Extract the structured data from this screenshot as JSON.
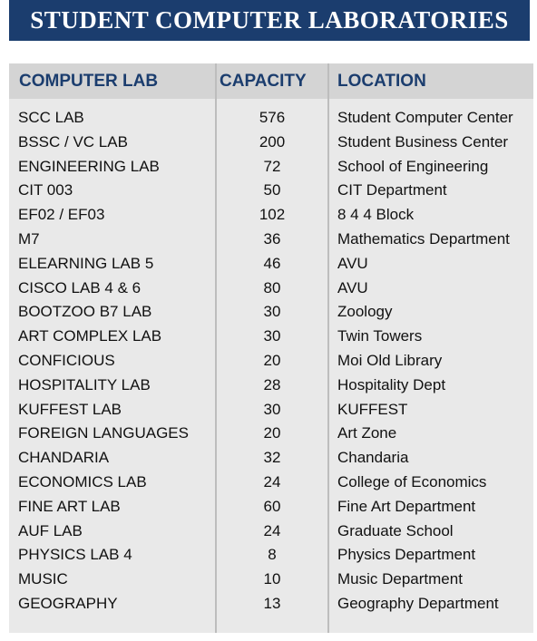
{
  "title": "STUDENT COMPUTER LABORATORIES",
  "colors": {
    "title_background": "#1b3d6e",
    "header_text": "#1b3d6e",
    "header_background": "#d4d4d4",
    "panel_background": "#e9e9e9"
  },
  "table": {
    "headers": [
      "COMPUTER LAB",
      "CAPACITY",
      "LOCATION"
    ],
    "rows": [
      {
        "lab": "SCC LAB",
        "capacity": "576",
        "location": "Student Computer Center"
      },
      {
        "lab": "BSSC / VC LAB",
        "capacity": "200",
        "location": "Student Business Center"
      },
      {
        "lab": "ENGINEERING LAB",
        "capacity": "72",
        "location": "School of Engineering"
      },
      {
        "lab": "CIT 003",
        "capacity": "50",
        "location": "CIT Department"
      },
      {
        "lab": "EF02 / EF03",
        "capacity": "102",
        "location": "8 4 4 Block"
      },
      {
        "lab": "M7",
        "capacity": "36",
        "location": "Mathematics Department"
      },
      {
        "lab": "ELEARNING LAB 5",
        "capacity": "46",
        "location": "AVU"
      },
      {
        "lab": "CISCO LAB 4 & 6",
        "capacity": "80",
        "location": "AVU"
      },
      {
        "lab": "BOOTZOO B7 LAB",
        "capacity": "30",
        "location": "Zoology"
      },
      {
        "lab": "ART COMPLEX LAB",
        "capacity": "30",
        "location": "Twin Towers"
      },
      {
        "lab": "CONFICIOUS",
        "capacity": "20",
        "location": "Moi Old Library"
      },
      {
        "lab": "HOSPITALITY LAB",
        "capacity": "28",
        "location": "Hospitality Dept"
      },
      {
        "lab": "KUFFEST LAB",
        "capacity": "30",
        "location": "KUFFEST"
      },
      {
        "lab": "FOREIGN LANGUAGES",
        "capacity": "20",
        "location": "Art Zone"
      },
      {
        "lab": "CHANDARIA",
        "capacity": "32",
        "location": "Chandaria"
      },
      {
        "lab": "ECONOMICS LAB",
        "capacity": "24",
        "location": "College of Economics"
      },
      {
        "lab": "FINE ART LAB",
        "capacity": "60",
        "location": "Fine Art Department"
      },
      {
        "lab": "AUF LAB",
        "capacity": "24",
        "location": "Graduate School"
      },
      {
        "lab": "PHYSICS LAB 4",
        "capacity": "8",
        "location": "Physics Department"
      },
      {
        "lab": "MUSIC",
        "capacity": "10",
        "location": "Music Department"
      },
      {
        "lab": "GEOGRAPHY",
        "capacity": "13",
        "location": "Geography Department"
      }
    ]
  }
}
